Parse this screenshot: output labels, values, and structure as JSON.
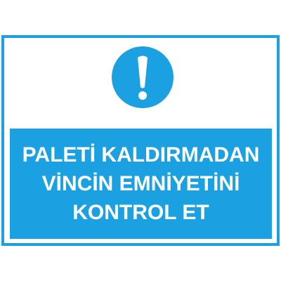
{
  "sign": {
    "icon": "exclamation-circle-icon",
    "color": "#1ba1e2",
    "lines": [
      "PALETİ KALDIRMADAN",
      "VİNCİN EMNİYETİNİ",
      "KONTROL ET"
    ]
  }
}
